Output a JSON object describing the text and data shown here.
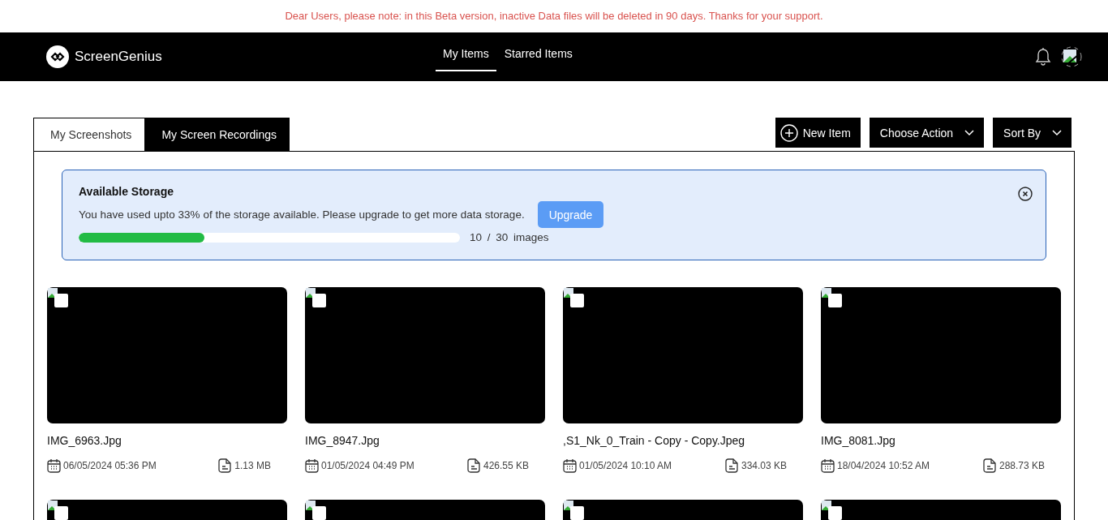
{
  "notice": "Dear Users, please note: in this Beta version, inactive Data files will be deleted in 90 days. Thanks for your support.",
  "header": {
    "brand": "ScreenGenius",
    "nav": [
      {
        "label": "My Items",
        "selected": true
      },
      {
        "label": "Starred Items",
        "selected": false
      }
    ]
  },
  "tabs": [
    {
      "label": "My Screenshots",
      "selected": true
    },
    {
      "label": "My Screen Recordings",
      "selected": false
    }
  ],
  "actions": [
    {
      "kind": "new",
      "label": "New Item"
    },
    {
      "kind": "dropdown",
      "label": "Choose Action"
    },
    {
      "kind": "dropdown",
      "label": "Sort By"
    }
  ],
  "storage": {
    "title": "Available Storage",
    "message": "You have used upto 33% of the storage available. Please upgrade to get more data storage.",
    "button": "Upgrade",
    "level": 0.33,
    "used": "10",
    "separator": "/",
    "total": "30",
    "unit": "images"
  },
  "items": [
    {
      "name": "IMG_6963.Jpg",
      "date": "06/05/2024 05:36 PM",
      "size": "1.13 MB",
      "checked": false
    },
    {
      "name": "IMG_8947.Jpg",
      "date": "01/05/2024 04:49 PM",
      "size": "426.55 KB",
      "checked": false
    },
    {
      "name": ",S1_Nk_0_Train - Copy - Copy.Jpeg",
      "date": "01/05/2024 10:10 AM",
      "size": "334.03 KB",
      "checked": false
    },
    {
      "name": "IMG_8081.Jpg",
      "date": "18/04/2024 10:52 AM",
      "size": "288.73 KB",
      "checked": false
    },
    {
      "checked": false
    },
    {
      "checked": false
    },
    {
      "checked": false
    },
    {
      "checked": false
    }
  ]
}
